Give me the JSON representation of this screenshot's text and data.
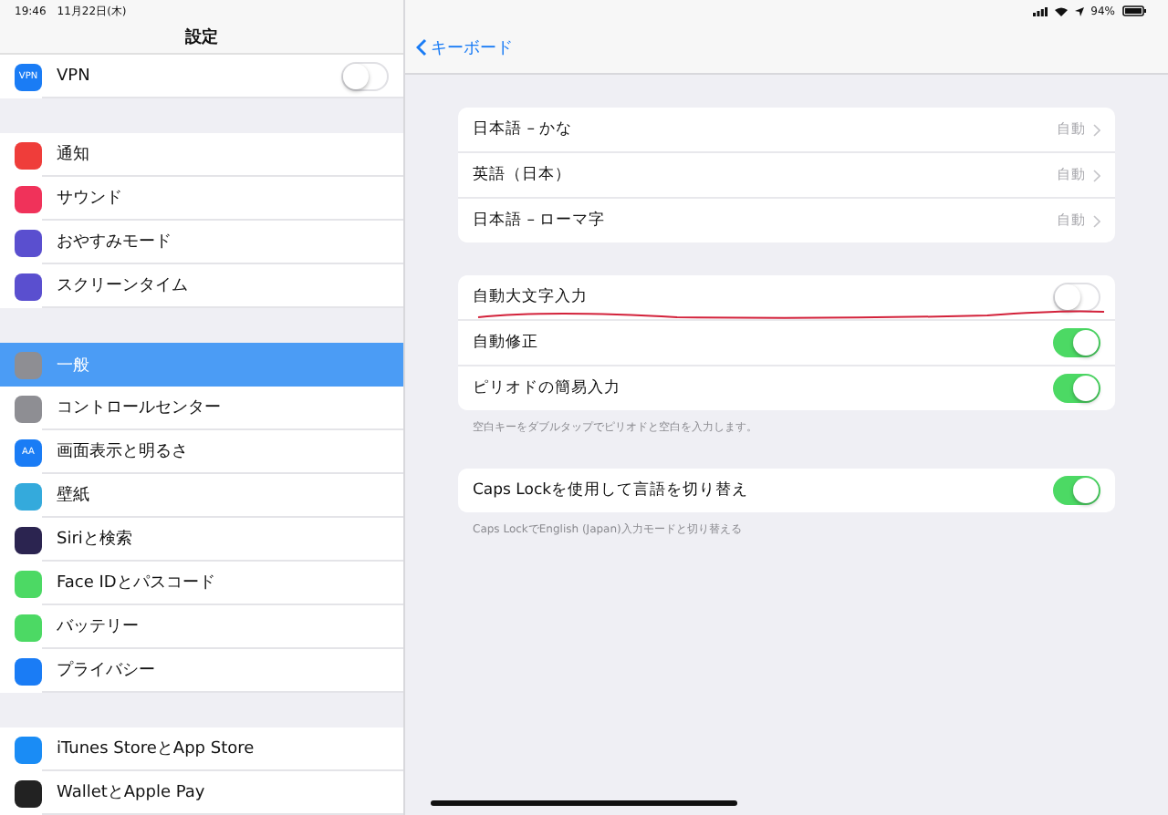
{
  "status_bar": {
    "time": "19:46",
    "date": "11月22日(木)",
    "battery": "94%"
  },
  "sidebar": {
    "title": "設定",
    "groups": [
      {
        "items": [
          {
            "label": "VPN",
            "color": "#1a7cf5",
            "icon_text": "VPN",
            "kind": "toggle",
            "on": false,
            "selected": false
          }
        ]
      },
      {
        "items": [
          {
            "label": "通知",
            "color": "#ef3d3a",
            "kind": "link",
            "selected": false
          },
          {
            "label": "サウンド",
            "color": "#f0325a",
            "kind": "link",
            "selected": false
          },
          {
            "label": "おやすみモード",
            "color": "#5a4fcf",
            "kind": "link",
            "selected": false
          },
          {
            "label": "スクリーンタイム",
            "color": "#5a4fcf",
            "kind": "link",
            "selected": false
          }
        ]
      },
      {
        "items": [
          {
            "label": "一般",
            "color": "#8e8e93",
            "kind": "link",
            "selected": true
          },
          {
            "label": "コントロールセンター",
            "color": "#8e8e93",
            "kind": "link",
            "selected": false
          },
          {
            "label": "画面表示と明るさ",
            "color": "#1a7cf5",
            "icon_text": "AA",
            "kind": "link",
            "selected": false
          },
          {
            "label": "壁紙",
            "color": "#34aadc",
            "kind": "link",
            "selected": false
          },
          {
            "label": "Siriと検索",
            "color": "#2b2450",
            "kind": "link",
            "selected": false
          },
          {
            "label": "Face IDとパスコード",
            "color": "#4cd964",
            "kind": "link",
            "selected": false
          },
          {
            "label": "バッテリー",
            "color": "#4cd964",
            "kind": "link",
            "selected": false
          },
          {
            "label": "プライバシー",
            "color": "#1a7cf5",
            "kind": "link",
            "selected": false
          }
        ]
      },
      {
        "items": [
          {
            "label": "iTunes StoreとApp Store",
            "color": "#1a8cf5",
            "kind": "link",
            "selected": false
          },
          {
            "label": "WalletとApple Pay",
            "color": "#222222",
            "kind": "link",
            "selected": false
          }
        ]
      }
    ]
  },
  "detail": {
    "back": "キーボード",
    "sections": [
      {
        "rows": [
          {
            "kind": "link",
            "label": "日本語 – かな",
            "value": "自動"
          },
          {
            "kind": "link",
            "label": "英語（日本）",
            "value": "自動"
          },
          {
            "kind": "link",
            "label": "日本語 – ローマ字",
            "value": "自動"
          }
        ]
      },
      {
        "rows": [
          {
            "kind": "toggle",
            "label": "自動大文字入力",
            "on": false,
            "marked": true
          },
          {
            "kind": "toggle",
            "label": "自動修正",
            "on": true
          },
          {
            "kind": "toggle",
            "label": "ピリオドの簡易入力",
            "on": true
          }
        ],
        "footer": "空白キーをダブルタップでピリオドと空白を入力します。"
      },
      {
        "rows": [
          {
            "kind": "toggle",
            "label": "Caps Lockを使用して言語を切り替え",
            "on": true
          }
        ],
        "footer": "Caps LockでEnglish (Japan)入力モードと切り替える"
      }
    ]
  }
}
